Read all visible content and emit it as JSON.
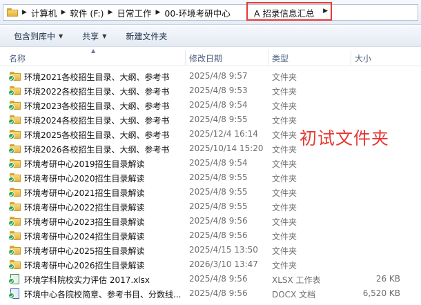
{
  "address": {
    "crumbs": [
      "计算机",
      "软件 (F:)",
      "日常工作",
      "00-环境考研中心"
    ],
    "current": "A 招录信息汇总",
    "highlight_color": "#e53935"
  },
  "toolbar": {
    "include_label": "包含到库中",
    "share_label": "共享",
    "new_folder_label": "新建文件夹"
  },
  "columns": {
    "name": "名称",
    "date": "修改日期",
    "type": "类型",
    "size": "大小"
  },
  "files": [
    {
      "name": "环境2021各校招生目录、大纲、参考书",
      "date": "2025/4/8 9:57",
      "type": "文件夹",
      "size": "",
      "icon": "folder-icon"
    },
    {
      "name": "环境2022各校招生目录、大纲、参考书",
      "date": "2025/4/8 9:53",
      "type": "文件夹",
      "size": "",
      "icon": "folder-icon"
    },
    {
      "name": "环境2023各校招生目录、大纲、参考书",
      "date": "2025/4/8 9:54",
      "type": "文件夹",
      "size": "",
      "icon": "folder-icon"
    },
    {
      "name": "环境2024各校招生目录、大纲、参考书",
      "date": "2025/4/8 9:55",
      "type": "文件夹",
      "size": "",
      "icon": "folder-icon"
    },
    {
      "name": "环境2025各校招生目录、大纲、参考书",
      "date": "2025/12/4 16:14",
      "type": "文件夹",
      "size": "",
      "icon": "folder-icon"
    },
    {
      "name": "环境2026各校招生目录、大纲、参考书",
      "date": "2025/10/14 15:20",
      "type": "文件夹",
      "size": "",
      "icon": "folder-icon"
    },
    {
      "name": "环境考研中心2019招生目录解读",
      "date": "2025/4/8 9:54",
      "type": "文件夹",
      "size": "",
      "icon": "folder-icon"
    },
    {
      "name": "环境考研中心2020招生目录解读",
      "date": "2025/4/8 9:55",
      "type": "文件夹",
      "size": "",
      "icon": "folder-icon"
    },
    {
      "name": "环境考研中心2021招生目录解读",
      "date": "2025/4/8 9:55",
      "type": "文件夹",
      "size": "",
      "icon": "folder-icon"
    },
    {
      "name": "环境考研中心2022招生目录解读",
      "date": "2025/4/8 9:55",
      "type": "文件夹",
      "size": "",
      "icon": "folder-icon"
    },
    {
      "name": "环境考研中心2023招生目录解读",
      "date": "2025/4/8 9:56",
      "type": "文件夹",
      "size": "",
      "icon": "folder-icon"
    },
    {
      "name": "环境考研中心2024招生目录解读",
      "date": "2025/4/8 9:56",
      "type": "文件夹",
      "size": "",
      "icon": "folder-icon"
    },
    {
      "name": "环境考研中心2025招生目录解读",
      "date": "2025/4/15 13:50",
      "type": "文件夹",
      "size": "",
      "icon": "folder-icon"
    },
    {
      "name": "环境考研中心2026招生目录解读",
      "date": "2026/3/10 13:47",
      "type": "文件夹",
      "size": "",
      "icon": "folder-icon"
    },
    {
      "name": "环境学科院校实力评估 2017.xlsx",
      "date": "2025/4/8 9:56",
      "type": "XLSX 工作表",
      "size": "26 KB",
      "icon": "xlsx-icon"
    },
    {
      "name": "环境中心各院校简章、参考书目、分数线...",
      "date": "2025/4/8 9:56",
      "type": "DOCX 文档",
      "size": "6,520 KB",
      "icon": "docx-icon"
    }
  ],
  "annotation": "初试文件夹"
}
